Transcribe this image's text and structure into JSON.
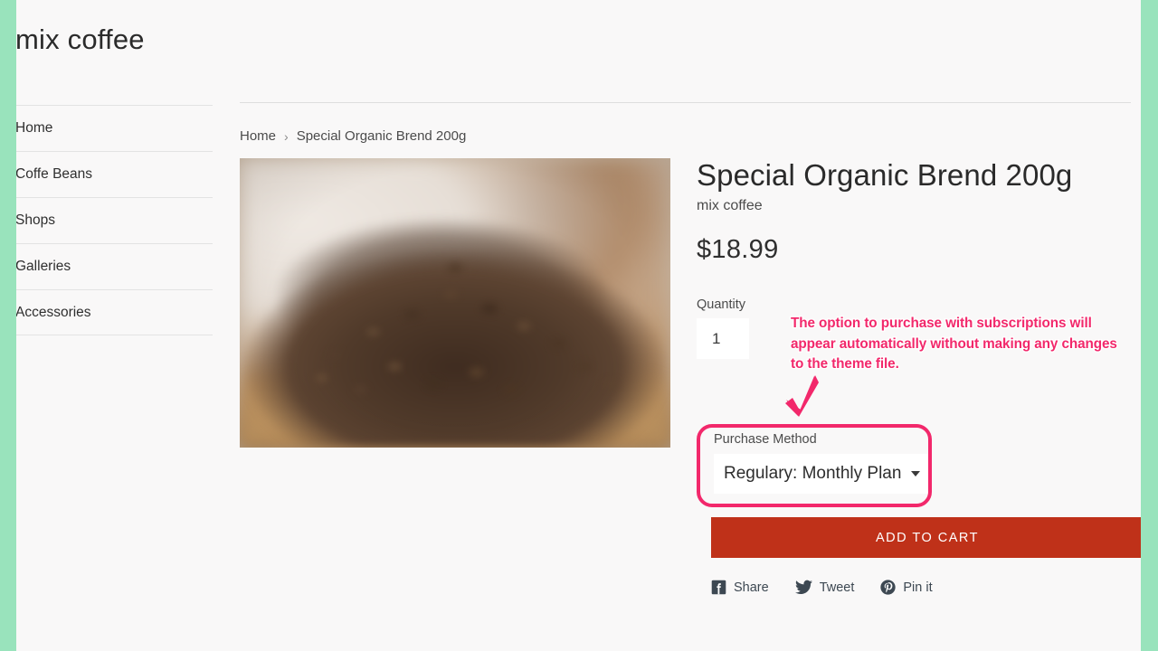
{
  "theme": {
    "page_border_color": "#99E3BC",
    "page_bg": "#F9F8F8",
    "accent_button_color": "#BF3119",
    "annotation_color": "#F2286B"
  },
  "sidebar": {
    "brand": "mix coffee",
    "nav_items": [
      {
        "label": "Home"
      },
      {
        "label": "Coffe Beans"
      },
      {
        "label": "Shops"
      },
      {
        "label": "Galleries"
      },
      {
        "label": "Accessories"
      }
    ]
  },
  "breadcrumb": {
    "home": "Home",
    "separator": "›",
    "current": "Special Organic Brend 200g"
  },
  "product": {
    "title": "Special Organic Brend 200g",
    "vendor": "mix coffee",
    "price": "$18.99",
    "image_alt": "coffee-beans-in-wooden-bowl",
    "quantity": {
      "label": "Quantity",
      "value": "1"
    },
    "purchase_method": {
      "label": "Purchase Method",
      "selected": "Regulary: Monthly Plan"
    },
    "add_to_cart_label": "ADD TO CART",
    "share": [
      {
        "icon": "facebook-icon",
        "label": "Share"
      },
      {
        "icon": "twitter-icon",
        "label": "Tweet"
      },
      {
        "icon": "pinterest-icon",
        "label": "Pin it"
      }
    ]
  },
  "annotation": {
    "text": "The option to purchase with subscriptions will appear automatically without making any changes to the theme file."
  }
}
